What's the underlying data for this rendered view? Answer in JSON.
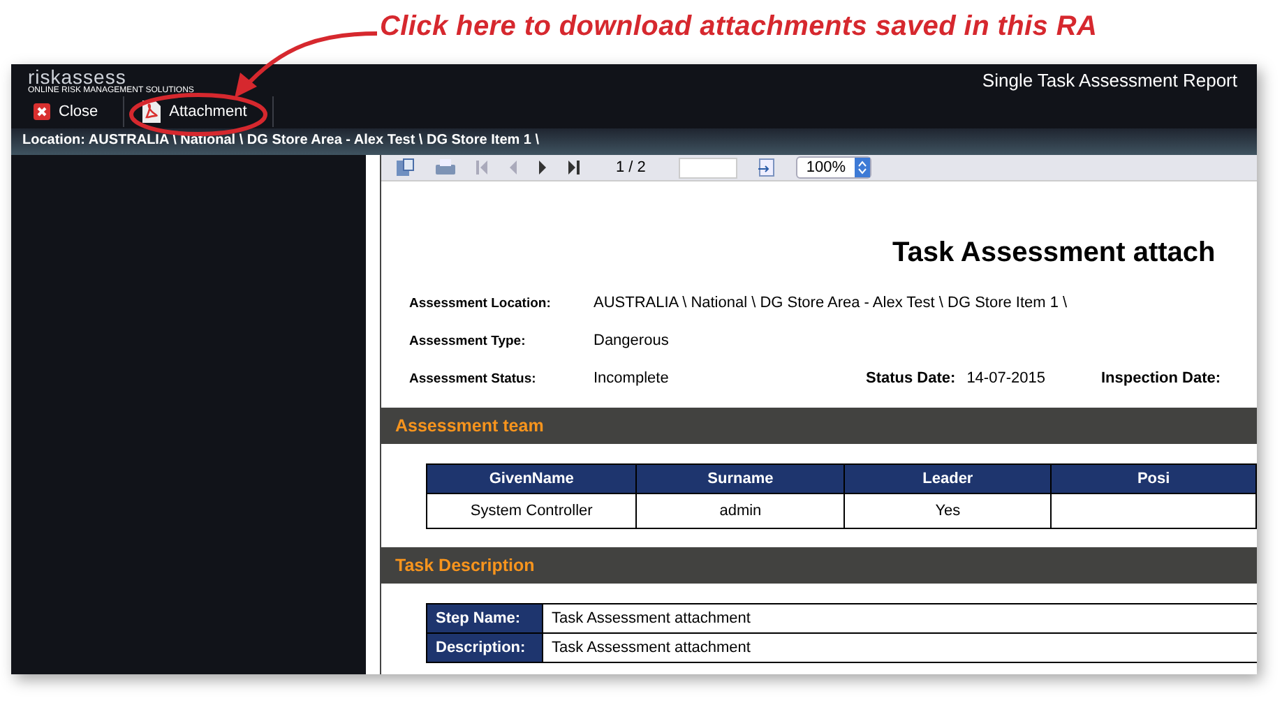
{
  "annotation": {
    "text": "Click here to download attachments saved in this RA"
  },
  "app": {
    "logo": {
      "name": "riskassess",
      "tagline": "ONLINE RISK MANAGEMENT SOLUTIONS"
    },
    "title": "Single Task Assessment Report",
    "toolbar": [
      {
        "kind": "close",
        "label": "Close"
      },
      {
        "kind": "pdf",
        "label": "Attachment"
      }
    ],
    "breadcrumb": "Location: AUSTRALIA \\ National \\ DG Store Area - Alex Test \\ DG Store Item 1 \\"
  },
  "viewer": {
    "page": "1 / 2",
    "zoom": "100%"
  },
  "report": {
    "title": "Task Assessment attach",
    "fields": [
      {
        "label": "Assessment Location:",
        "value": "AUSTRALIA \\ National \\ DG Store Area - Alex Test \\ DG Store Item 1 \\"
      },
      {
        "label": "Assessment Type:",
        "value": "Dangerous"
      },
      {
        "label": "Assessment Status:",
        "value": "Incomplete",
        "extra": [
          {
            "label": "Status Date:",
            "value": "14-07-2015"
          },
          {
            "label": "Inspection Date:"
          }
        ]
      }
    ],
    "team": {
      "heading": "Assessment team",
      "columns": [
        "GivenName",
        "Surname",
        "Leader",
        "Posi"
      ],
      "rows": [
        [
          "System Controller",
          "admin",
          "Yes",
          ""
        ]
      ]
    },
    "task": {
      "heading": "Task Description",
      "rows": [
        {
          "label": "Step Name:",
          "value": "Task Assessment attachment"
        },
        {
          "label": "Description:",
          "value": "Task Assessment attachment"
        }
      ]
    }
  }
}
